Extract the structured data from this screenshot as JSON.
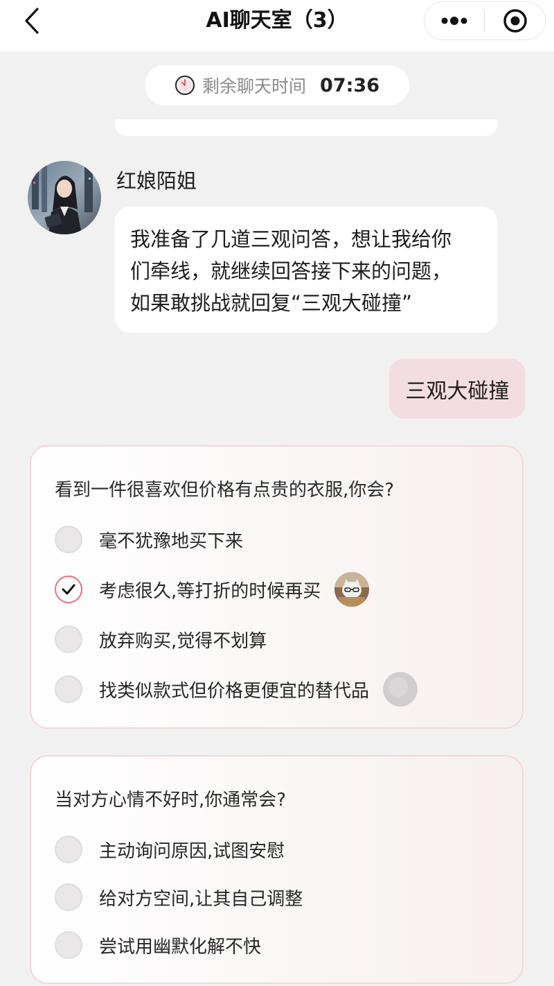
{
  "header": {
    "title": "AI聊天室（3）",
    "back_icon": "chevron-left-icon",
    "more_icon": "more-dots-icon",
    "record_icon": "target-icon"
  },
  "timer": {
    "label": "剩余聊天时间",
    "time": "07:36",
    "icon": "clock-icon"
  },
  "messages": {
    "ai": {
      "sender": "红娘陌姐",
      "text_lines": [
        "我准备了几道三观问答，想让我给你",
        "们牵线，就继续回答接下来的问题，",
        "如果敢挑战就回复“三观大碰撞”"
      ]
    },
    "user": {
      "text": "三观大碰撞"
    }
  },
  "questions": [
    {
      "question": "看到一件很喜欢但价格有点贵的衣服,你会?",
      "options": [
        {
          "label": "毫不犹豫地买下来",
          "checked": false
        },
        {
          "label": "考虑很久,等打折的时候再买",
          "checked": true
        },
        {
          "label": "放弃购买,觉得不划算",
          "checked": false
        },
        {
          "label": "找类似款式但价格更便宜的替代品",
          "checked": false
        }
      ]
    },
    {
      "question": "当对方心情不好时,你通常会?",
      "options": [
        {
          "label": "主动询问原因,试图安慰",
          "checked": false
        },
        {
          "label": "给对方空间,让其自己调整",
          "checked": false
        },
        {
          "label": "尝试用幽默化解不快",
          "checked": false
        }
      ]
    }
  ],
  "colors": {
    "accent": "#ec6f76",
    "user_bubble": "#f4dde2",
    "card_border": "#f6d6d9",
    "background": "#f2f1f1"
  }
}
